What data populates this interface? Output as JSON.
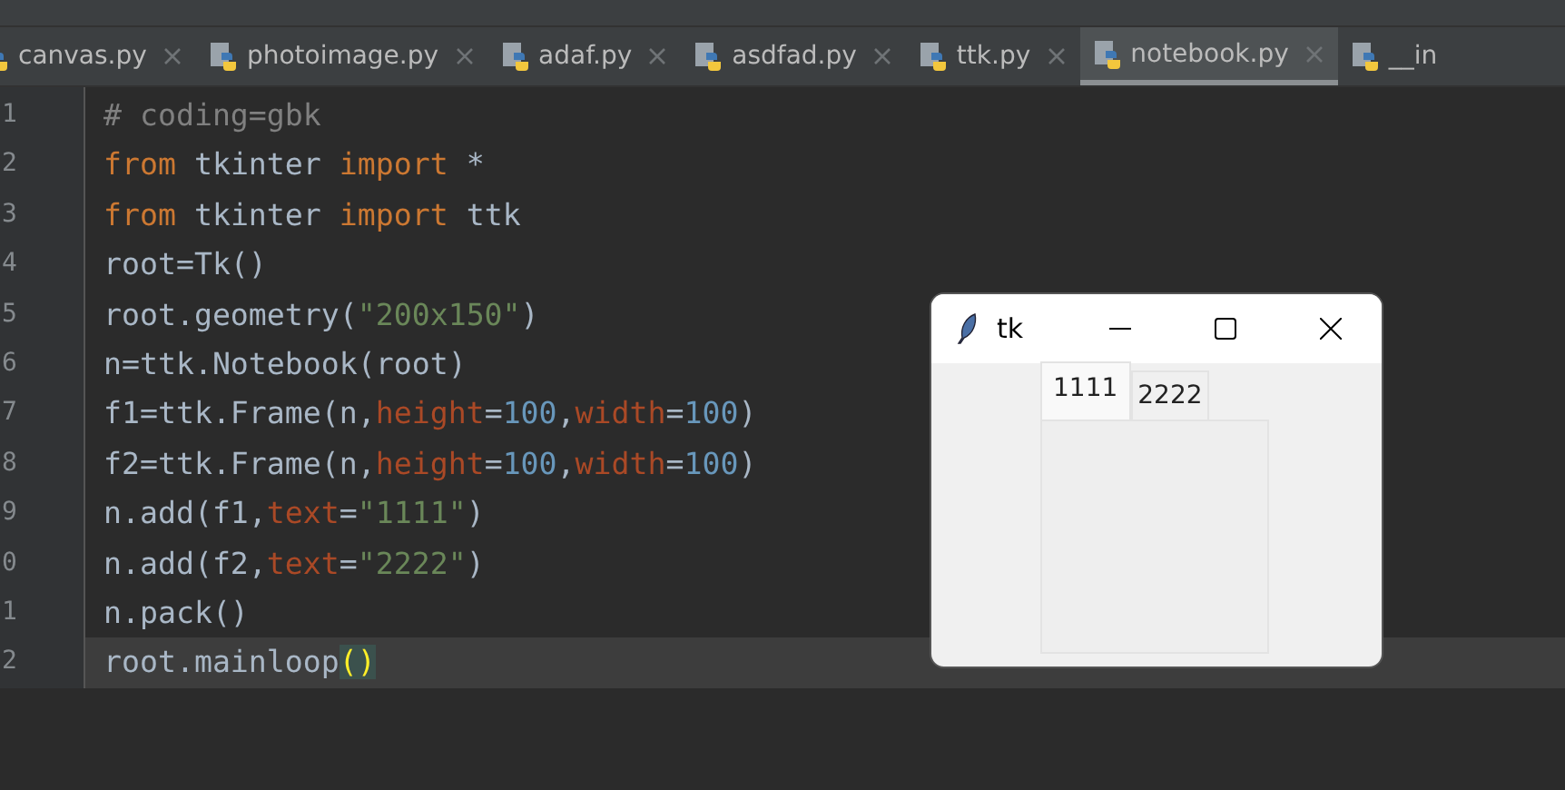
{
  "editor_tabs": [
    {
      "label": "canvas.py",
      "selected": false
    },
    {
      "label": "photoimage.py",
      "selected": false
    },
    {
      "label": "adaf.py",
      "selected": false
    },
    {
      "label": "asdfad.py",
      "selected": false
    },
    {
      "label": "ttk.py",
      "selected": false
    },
    {
      "label": "notebook.py",
      "selected": true
    },
    {
      "label": "__in",
      "selected": false
    }
  ],
  "gutter": {
    "line_numbers": [
      "1",
      "2",
      "3",
      "4",
      "5",
      "6",
      "7",
      "8",
      "9",
      "0",
      "1",
      "2"
    ]
  },
  "code_lines": [
    {
      "current": false,
      "tokens": [
        {
          "kind": "comment",
          "text": "# coding=gbk"
        }
      ]
    },
    {
      "current": false,
      "tokens": [
        {
          "kind": "keyword",
          "text": "from"
        },
        {
          "kind": "plain",
          "text": " tkinter "
        },
        {
          "kind": "keyword",
          "text": "import"
        },
        {
          "kind": "plain",
          "text": " *"
        }
      ]
    },
    {
      "current": false,
      "tokens": [
        {
          "kind": "keyword",
          "text": "from"
        },
        {
          "kind": "plain",
          "text": " tkinter "
        },
        {
          "kind": "keyword",
          "text": "import"
        },
        {
          "kind": "plain",
          "text": " ttk"
        }
      ]
    },
    {
      "current": false,
      "tokens": [
        {
          "kind": "plain",
          "text": "root=Tk()"
        }
      ]
    },
    {
      "current": false,
      "tokens": [
        {
          "kind": "plain",
          "text": "root.geometry("
        },
        {
          "kind": "string",
          "text": "\"200x150\""
        },
        {
          "kind": "plain",
          "text": ")"
        }
      ]
    },
    {
      "current": false,
      "tokens": [
        {
          "kind": "plain",
          "text": "n=ttk.Notebook(root)"
        }
      ]
    },
    {
      "current": false,
      "tokens": [
        {
          "kind": "plain",
          "text": "f1=ttk.Frame(n,"
        },
        {
          "kind": "param",
          "text": "height"
        },
        {
          "kind": "plain",
          "text": "="
        },
        {
          "kind": "number",
          "text": "100"
        },
        {
          "kind": "plain",
          "text": ","
        },
        {
          "kind": "param",
          "text": "width"
        },
        {
          "kind": "plain",
          "text": "="
        },
        {
          "kind": "number",
          "text": "100"
        },
        {
          "kind": "plain",
          "text": ")"
        }
      ]
    },
    {
      "current": false,
      "tokens": [
        {
          "kind": "plain",
          "text": "f2=ttk.Frame(n,"
        },
        {
          "kind": "param",
          "text": "height"
        },
        {
          "kind": "plain",
          "text": "="
        },
        {
          "kind": "number",
          "text": "100"
        },
        {
          "kind": "plain",
          "text": ","
        },
        {
          "kind": "param",
          "text": "width"
        },
        {
          "kind": "plain",
          "text": "="
        },
        {
          "kind": "number",
          "text": "100"
        },
        {
          "kind": "plain",
          "text": ")"
        }
      ]
    },
    {
      "current": false,
      "tokens": [
        {
          "kind": "plain",
          "text": "n.add(f1,"
        },
        {
          "kind": "param",
          "text": "text"
        },
        {
          "kind": "plain",
          "text": "="
        },
        {
          "kind": "string",
          "text": "\"1111\""
        },
        {
          "kind": "plain",
          "text": ")"
        }
      ]
    },
    {
      "current": false,
      "tokens": [
        {
          "kind": "plain",
          "text": "n.add(f2,"
        },
        {
          "kind": "param",
          "text": "text"
        },
        {
          "kind": "plain",
          "text": "="
        },
        {
          "kind": "string",
          "text": "\"2222\""
        },
        {
          "kind": "plain",
          "text": ")"
        }
      ]
    },
    {
      "current": false,
      "tokens": [
        {
          "kind": "plain",
          "text": "n.pack()"
        }
      ]
    },
    {
      "current": true,
      "tokens": [
        {
          "kind": "plain",
          "text": "root.mainloop"
        },
        {
          "kind": "match",
          "text": "()"
        }
      ]
    }
  ],
  "tk_window": {
    "title": "tk",
    "notebook_tabs": [
      {
        "label": "1111",
        "selected": true
      },
      {
        "label": "2222",
        "selected": false
      }
    ]
  }
}
